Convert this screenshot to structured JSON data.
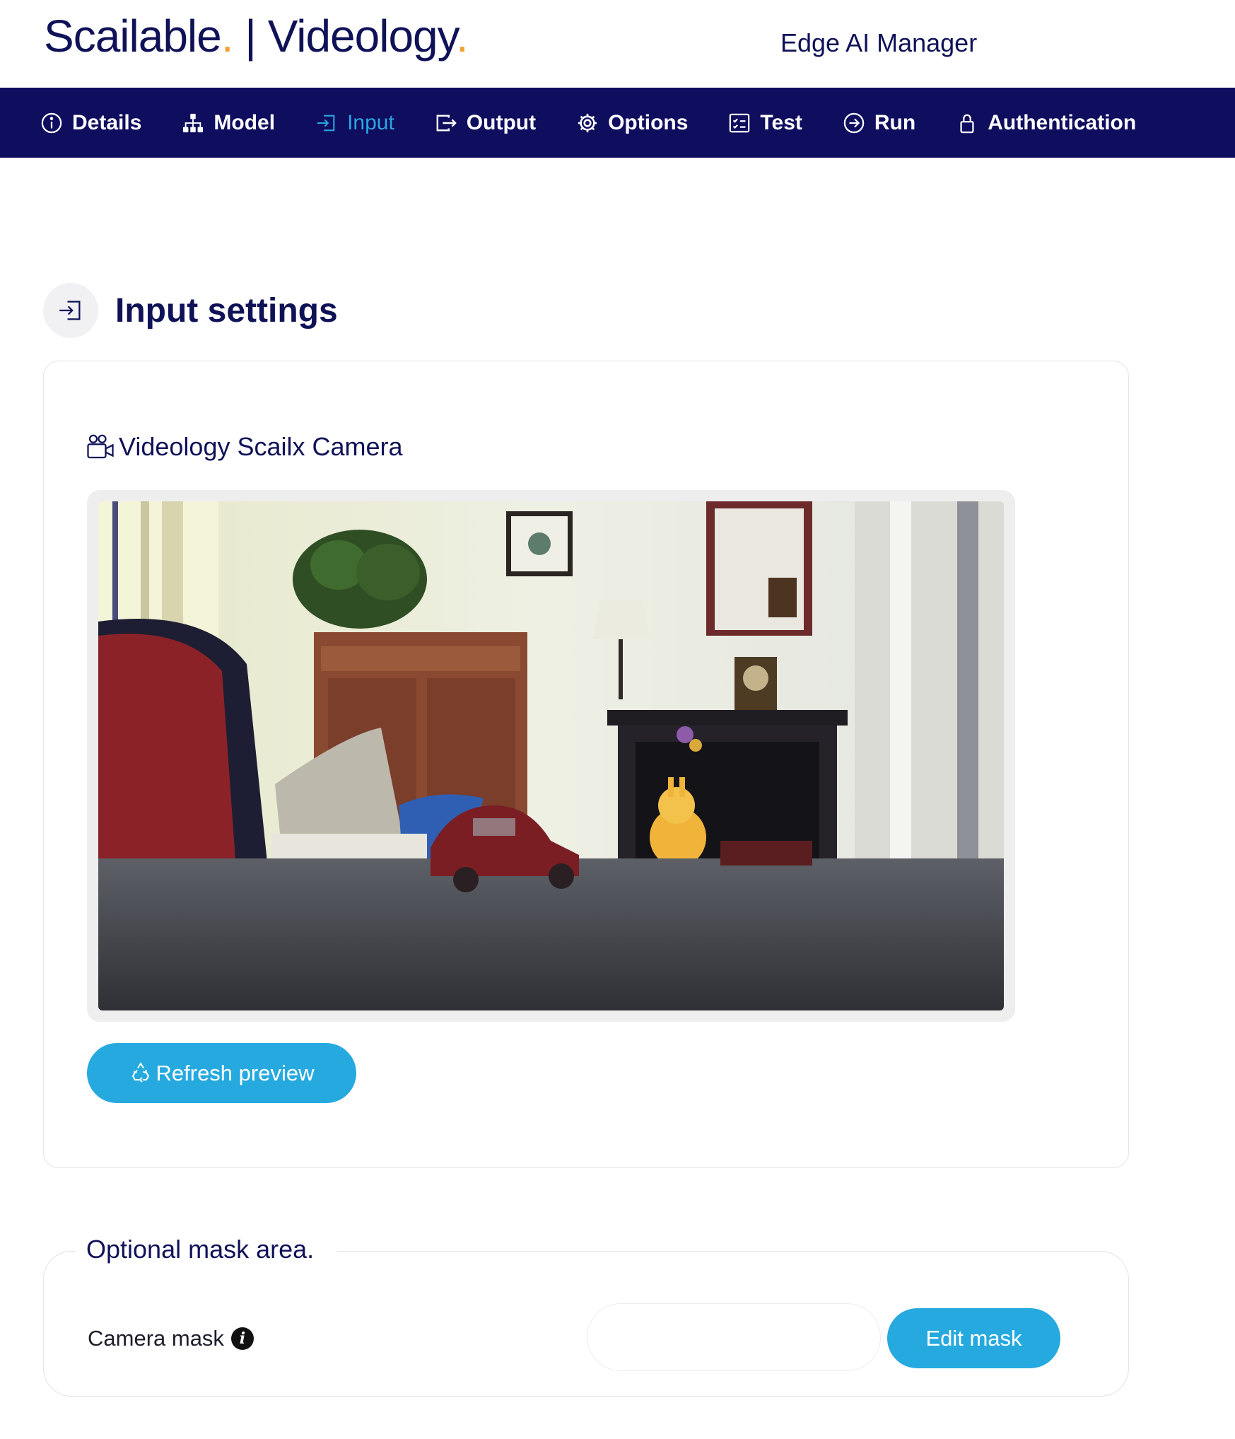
{
  "header": {
    "brand_part1": "Scailable",
    "brand_separator": " | ",
    "brand_part2": "Videology",
    "brand_dot": ".",
    "subtitle": "Edge AI Manager"
  },
  "nav": {
    "items": [
      {
        "label": "Details",
        "icon": "info-circle-icon",
        "active": false
      },
      {
        "label": "Model",
        "icon": "diagram-icon",
        "active": false
      },
      {
        "label": "Input",
        "icon": "box-arrow-in-icon",
        "active": true
      },
      {
        "label": "Output",
        "icon": "box-arrow-out-icon",
        "active": false
      },
      {
        "label": "Options",
        "icon": "gear-icon",
        "active": false
      },
      {
        "label": "Test",
        "icon": "checklist-icon",
        "active": false
      },
      {
        "label": "Run",
        "icon": "arrow-circle-icon",
        "active": false
      },
      {
        "label": "Authentication",
        "icon": "lock-icon",
        "active": false
      }
    ]
  },
  "section": {
    "title": "Input settings",
    "icon": "box-arrow-in-icon"
  },
  "camera": {
    "title": "Videology Scailx Camera",
    "icon": "camera-reels-icon",
    "refresh_label": "Refresh preview",
    "refresh_icon": "recycle-icon"
  },
  "mask": {
    "legend": "Optional mask area.",
    "label": "Camera mask",
    "info_icon": "info-icon",
    "input_value": "",
    "edit_label": "Edit mask"
  },
  "colors": {
    "navy": "#0f0d5e",
    "accent": "#26a9df",
    "brand_dot": "#f0a035"
  }
}
